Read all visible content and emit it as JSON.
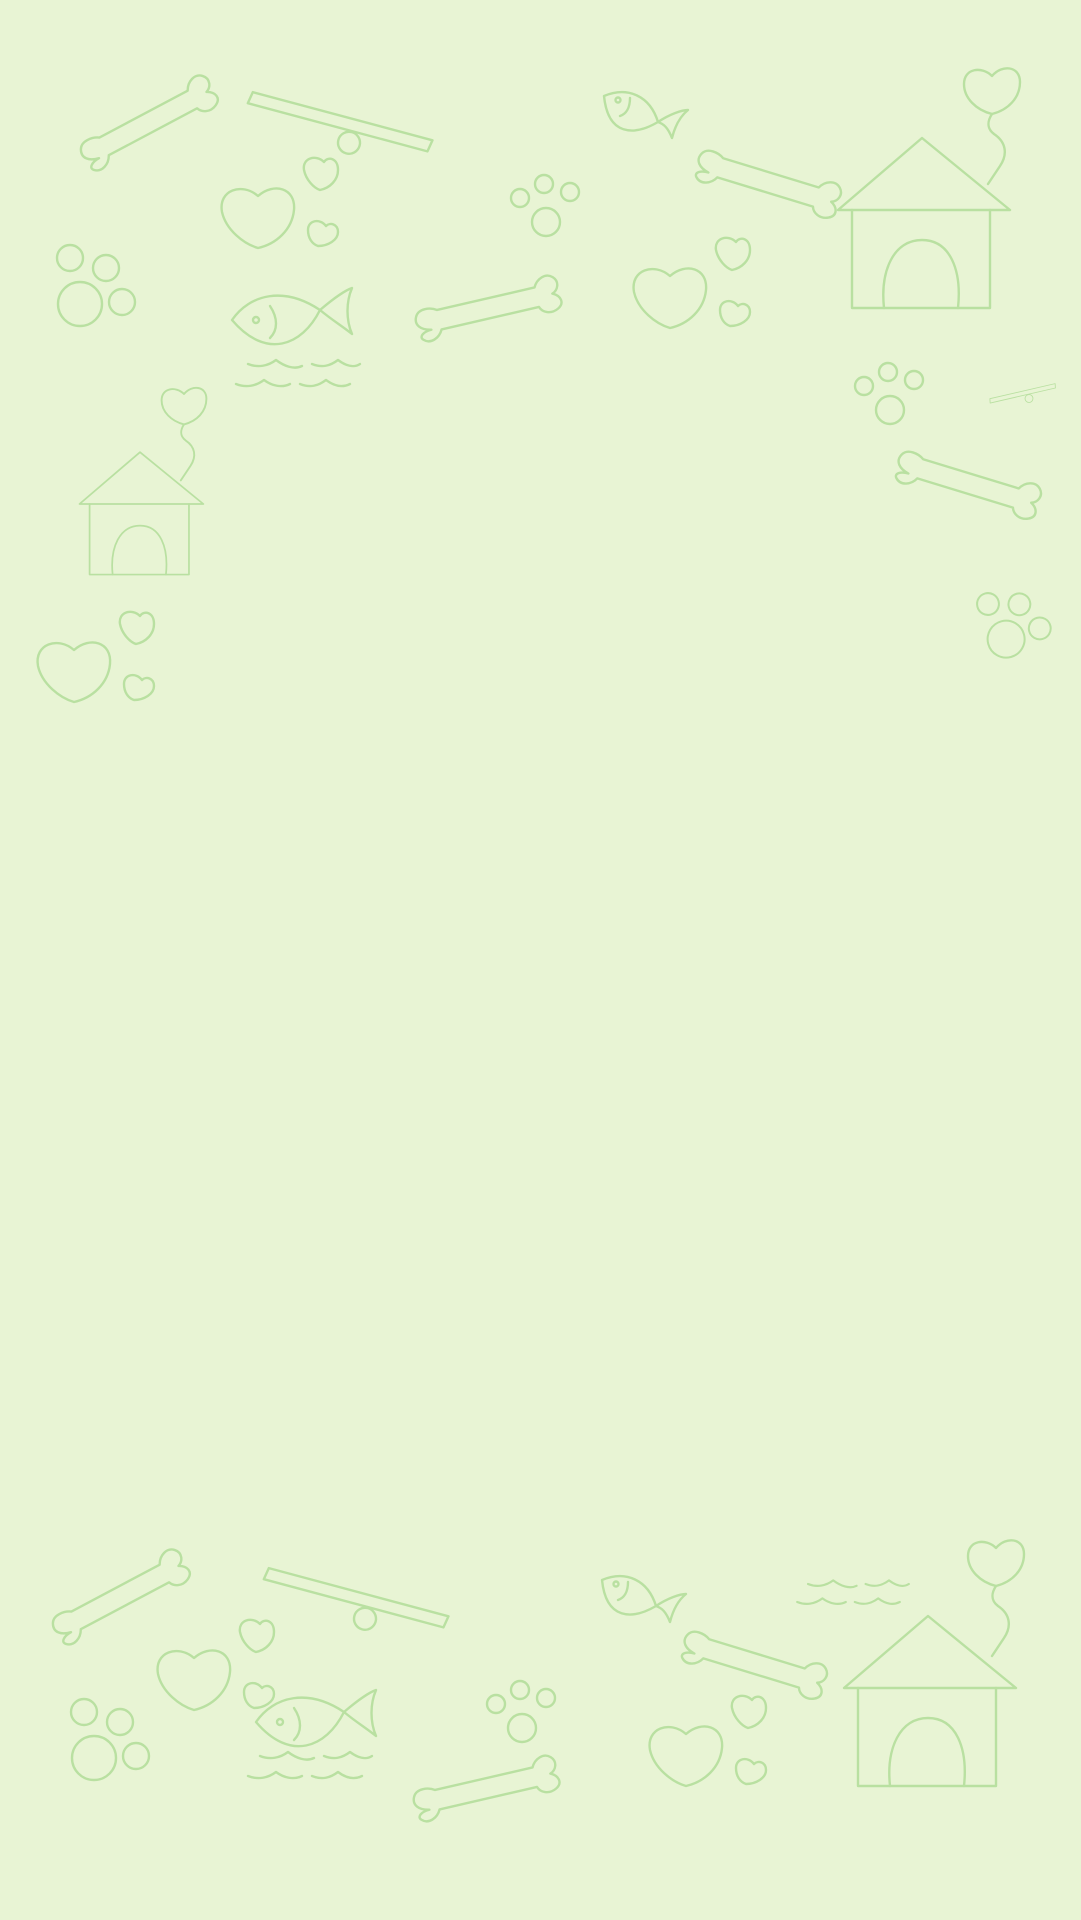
{
  "background_color": "#e8f4d4",
  "line_color": "#b9e0a1",
  "decorations": {
    "top_band": [
      "bone-icon",
      "seesaw-icon",
      "fish-icon",
      "bone-icon",
      "heart-balloon-icon",
      "heart-icon",
      "paw-print-icon",
      "doghouse-icon",
      "paw-print-icon",
      "fish-icon",
      "water-waves-icon",
      "bone-icon",
      "heart-icon",
      "paw-print-icon",
      "seesaw-icon",
      "doghouse-icon",
      "heart-balloon-icon",
      "bone-icon",
      "paw-print-icon",
      "heart-icon"
    ],
    "bottom_band": [
      "bone-icon",
      "seesaw-icon",
      "fish-icon",
      "bone-icon",
      "heart-icon",
      "paw-print-icon",
      "heart-icon",
      "fish-icon",
      "water-waves-icon",
      "bone-icon",
      "paw-print-icon",
      "heart-icon",
      "water-waves-icon",
      "doghouse-icon",
      "heart-balloon-icon"
    ]
  }
}
